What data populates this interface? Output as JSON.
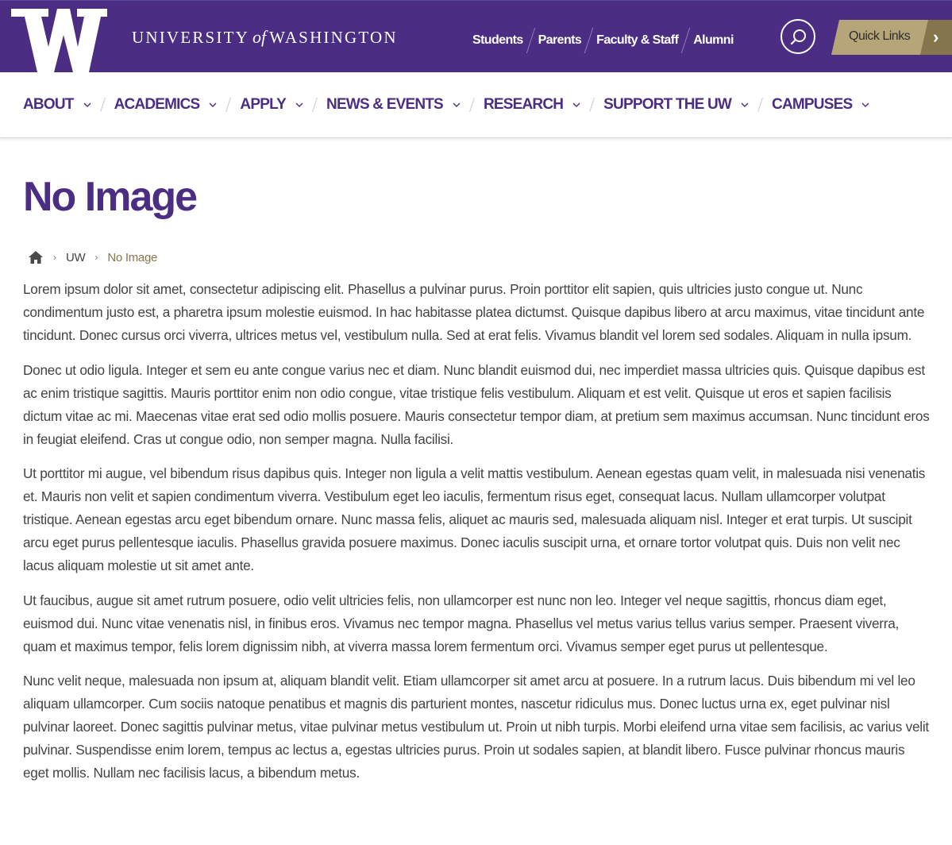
{
  "site": {
    "logo_letter": "W",
    "wordmark": {
      "part1": "UNIVERSITY",
      "of": "of",
      "part2": "WASHINGTON"
    }
  },
  "audience_links": [
    "Students",
    "Parents",
    "Faculty & Staff",
    "Alumni"
  ],
  "search_icon": "search-icon",
  "quick_links_label": "Quick Links",
  "nav": [
    {
      "label": "ABOUT"
    },
    {
      "label": "ACADEMICS"
    },
    {
      "label": "APPLY"
    },
    {
      "label": "NEWS & EVENTS"
    },
    {
      "label": "RESEARCH"
    },
    {
      "label": "SUPPORT THE UW"
    },
    {
      "label": "CAMPUSES"
    }
  ],
  "page": {
    "title": "No Image"
  },
  "breadcrumb": {
    "home_icon": "home-icon",
    "items": [
      "UW"
    ],
    "current": "No Image"
  },
  "paragraphs": [
    "Lorem ipsum dolor sit amet, consectetur adipiscing elit. Phasellus a pulvinar purus. Proin porttitor elit sapien, quis ultricies justo congue ut. Nunc condimentum justo est, a pharetra ipsum molestie euismod. In hac habitasse platea dictumst. Quisque dapibus libero at arcu maximus, vitae tincidunt ante tincidunt. Donec cursus orci viverra, ultrices metus vel, vestibulum nulla. Sed at erat felis. Vivamus blandit vel lorem sed sodales. Aliquam in nulla ipsum.",
    "Donec ut odio ligula. Integer et sem eu ante congue varius nec et diam. Nunc blandit euismod dui, nec imperdiet massa ultricies quis. Quisque dapibus est ac enim tristique sagittis. Mauris porttitor enim non odio congue, vitae tristique felis vestibulum. Aliquam et est velit. Quisque ut eros et sapien facilisis dictum vitae ac mi. Maecenas vitae erat sed odio mollis posuere. Mauris consectetur tempor diam, at pretium sem maximus accumsan. Nunc tincidunt eros in feugiat eleifend. Cras ut congue odio, non semper magna. Nulla facilisi.",
    "Ut porttitor mi augue, vel bibendum risus dapibus quis. Integer non ligula a velit mattis vestibulum. Aenean egestas quam velit, in malesuada nisi venenatis et. Mauris non velit et sapien condimentum viverra. Vestibulum eget leo iaculis, fermentum risus eget, consequat lacus. Nullam ullamcorper volutpat tristique. Aenean egestas arcu eget bibendum ornare. Nunc massa felis, aliquet ac mauris sed, malesuada aliquam nisl. Integer et erat turpis. Ut suscipit arcu eget purus pellentesque iaculis. Phasellus gravida posuere maximus. Donec iaculis suscipit urna, et ornare tortor volutpat quis. Duis non velit nec lacus aliquam molestie ut sit amet ante.",
    "Ut faucibus, augue sit amet rutrum posuere, odio velit ultricies felis, non ullamcorper est nunc non leo. Integer vel neque sagittis, rhoncus diam eget, euismod dui. Nunc vitae venenatis nisl, in finibus eros. Vivamus nec tempor magna. Phasellus vel metus varius tellus varius semper. Praesent viverra, quam et maximus tempor, felis lorem dignissim nibh, at viverra massa lorem fermentum orci. Vivamus semper eget purus ut pellentesque.",
    "Nunc velit neque, malesuada non ipsum at, aliquam blandit velit. Etiam ullamcorper sit amet arcu at posuere. In a rutrum lacus. Duis bibendum mi vel leo aliquam ullamcorper. Cum sociis natoque penatibus et magnis dis parturient montes, nascetur ridiculus mus. Donec luctus urna ex, eget pulvinar nisl pulvinar laoreet. Donec sagittis pulvinar metus, vitae pulvinar metus vestibulum ut. Proin ut nibh turpis. Morbi eleifend urna vitae sem facilisis, ac varius velit pulvinar. Suspendisse enim lorem, tempus ac lectus a, egestas ultricies purus. Proin ut sodales sapien, at blandit libero. Fusce pulvinar rhoncus mauris eget mollis. Nullam nec facilisis lacus, a bibendum metus."
  ],
  "colors": {
    "purple": "#4b2e83",
    "gold": "#b7a57a",
    "dark_gold": "#85754d",
    "text": "#444444"
  }
}
